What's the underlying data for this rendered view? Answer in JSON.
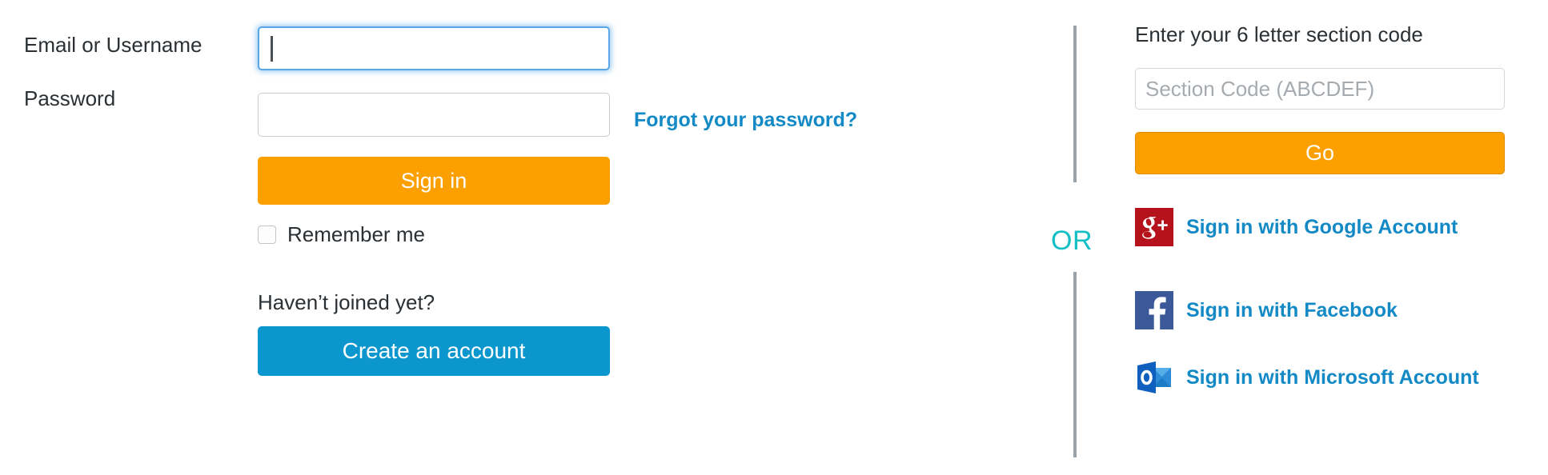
{
  "login_form": {
    "email_label": "Email or Username",
    "email_value": "",
    "email_placeholder": "",
    "password_label": "Password",
    "password_value": "",
    "password_placeholder": "",
    "forgot_password_link": "Forgot your password?",
    "sign_in_button": "Sign in",
    "remember_me_label": "Remember me",
    "remember_me_checked": false,
    "havent_joined_text": "Haven’t joined yet?",
    "create_account_button": "Create an account"
  },
  "divider": {
    "or_label": "OR"
  },
  "section_code": {
    "heading": "Enter your 6 letter section code",
    "input_value": "",
    "input_placeholder": "Section Code (ABCDEF)",
    "go_button": "Go"
  },
  "oauth": {
    "providers": [
      {
        "label": "Sign in with Google Account",
        "icon": "google-plus-icon"
      },
      {
        "label": "Sign in with Facebook",
        "icon": "facebook-icon"
      },
      {
        "label": "Sign in with Microsoft Account",
        "icon": "outlook-icon"
      }
    ]
  },
  "colors": {
    "accent_orange": "#FCA000",
    "accent_blue": "#0B97CD",
    "link_blue": "#1389C6",
    "or_teal": "#13BFC4",
    "focus_ring": "#5AA7E8",
    "divider_gray": "#9AA3AA",
    "text_dark": "#2B3034",
    "placeholder_gray": "#A6ABB0",
    "google_red": "#B5121B",
    "facebook_blue": "#3B5998",
    "outlook_blue": "#0F5FBF"
  }
}
